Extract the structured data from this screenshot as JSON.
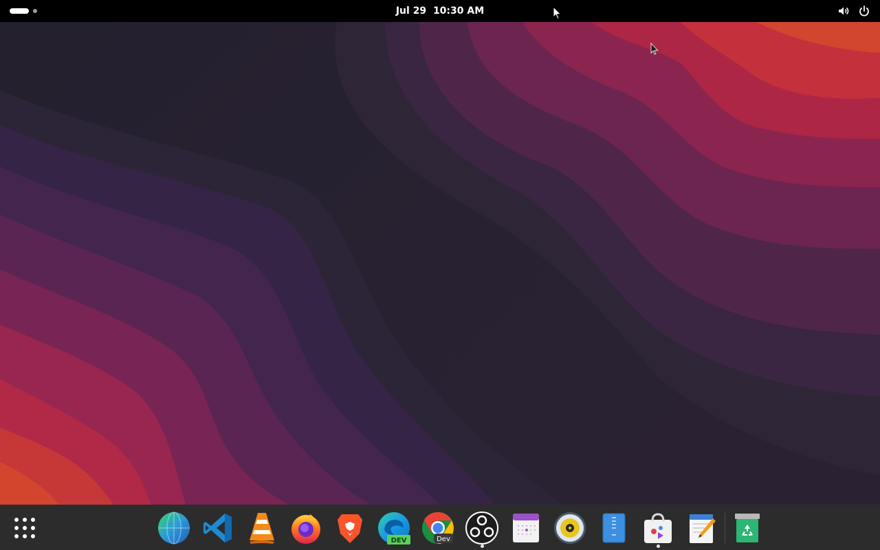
{
  "top_bar": {
    "date": "Jul 29",
    "time": "10:30 AM",
    "icons": [
      "activities-indicator-icon",
      "volume-icon",
      "power-icon"
    ]
  },
  "dock": {
    "apps": [
      {
        "name": "globe-browser-icon"
      },
      {
        "name": "vscode-icon"
      },
      {
        "name": "vlc-icon"
      },
      {
        "name": "firefox-icon"
      },
      {
        "name": "brave-icon"
      },
      {
        "name": "edge-dev-icon",
        "badge": "DEV"
      },
      {
        "name": "chrome-dev-icon",
        "badge": "Dev"
      },
      {
        "name": "obs-icon",
        "running": true
      },
      {
        "name": "calendar-icon"
      },
      {
        "name": "rhythmbox-icon"
      },
      {
        "name": "file-manager-icon"
      },
      {
        "name": "software-store-icon",
        "running": true
      },
      {
        "name": "text-editor-icon"
      },
      {
        "name": "trash-icon"
      }
    ]
  },
  "colors": {
    "wallpaper_dark": "#22202c",
    "wallpaper_purple": "#3b2446",
    "wallpaper_magenta": "#7c2454",
    "wallpaper_red": "#b8263f",
    "wallpaper_orange": "#d6402c",
    "top_bar_bg": "#000000",
    "dock_bg": "#2c2c2c"
  }
}
